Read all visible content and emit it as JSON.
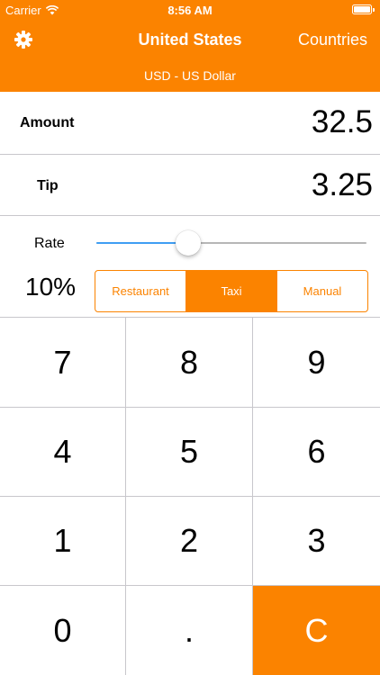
{
  "status_bar": {
    "carrier": "Carrier",
    "time": "8:56 AM",
    "wifi_icon": "wifi-icon",
    "battery_icon": "battery-icon"
  },
  "nav": {
    "settings_icon": "gear-icon",
    "title": "United States",
    "countries_label": "Countries",
    "currency": "USD - US Dollar"
  },
  "amount": {
    "label": "Amount",
    "value": "32.5"
  },
  "tip": {
    "label": "Tip",
    "value": "3.25"
  },
  "rate": {
    "label": "Rate",
    "percent_text": "10%",
    "slider_fraction": 0.34,
    "modes": [
      {
        "label": "Restaurant",
        "selected": false
      },
      {
        "label": "Taxi",
        "selected": true
      },
      {
        "label": "Manual",
        "selected": false
      }
    ]
  },
  "keypad": {
    "keys": [
      "7",
      "8",
      "9",
      "4",
      "5",
      "6",
      "1",
      "2",
      "3",
      "0",
      ".",
      "C"
    ]
  },
  "colors": {
    "accent": "#fb8300",
    "slider_fill": "#3f9ef3",
    "separator": "#c8c7cc"
  }
}
